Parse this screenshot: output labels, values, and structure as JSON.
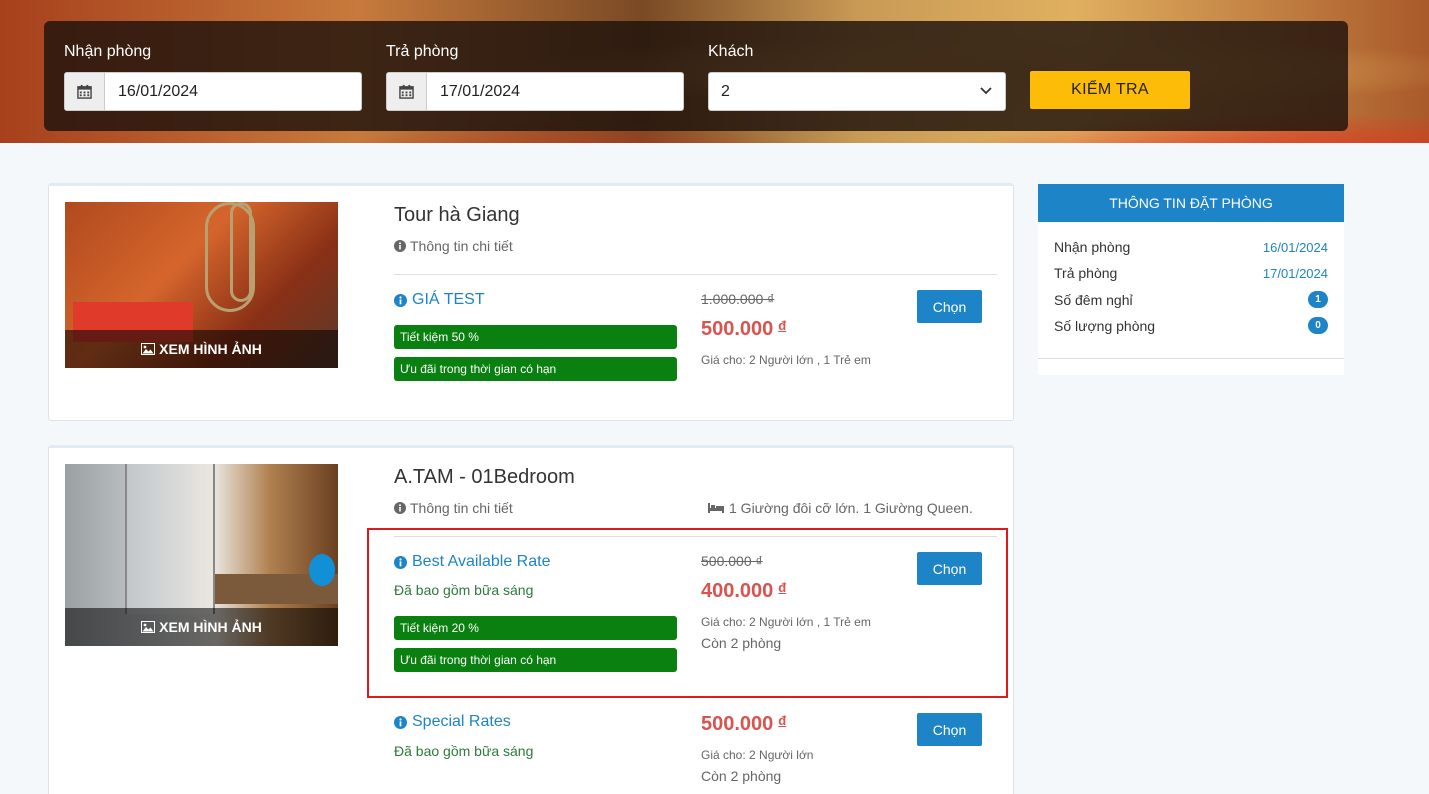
{
  "search": {
    "checkin_label": "Nhận phòng",
    "checkin_value": "16/01/2024",
    "checkout_label": "Trả phòng",
    "checkout_value": "17/01/2024",
    "guests_label": "Khách",
    "guests_value": "2",
    "check_button": "KIỂM TRA"
  },
  "rooms": [
    {
      "name": "Tour hà Giang",
      "info_link": "Thông tin chi tiết",
      "view_photos": "XEM HÌNH ẢNH",
      "rates": [
        {
          "name": "GIÁ TEST",
          "badges": [
            "Tiết kiệm 50 %",
            "Ưu đãi trong thời gian có hạn"
          ],
          "old_price": "1.000.000 ₫",
          "price": "500.000",
          "currency": "đ",
          "price_for": "Giá cho: 2 Người lớn , 1 Trẻ em",
          "button": "Chọn"
        }
      ]
    },
    {
      "name": "A.TAM - 01Bedroom",
      "info_link": "Thông tin chi tiết",
      "beds": "1 Giường đôi cỡ lớn. 1 Giường Queen.",
      "view_photos": "XEM HÌNH ẢNH",
      "rates": [
        {
          "name": "Best Available Rate",
          "breakfast": "Đã bao gồm bữa sáng",
          "badges": [
            "Tiết kiệm 20 %",
            "Ưu đãi trong thời gian có hạn"
          ],
          "old_price": "500.000 ₫",
          "price": "400.000",
          "currency": "đ",
          "price_for": "Giá cho: 2 Người lớn , 1 Trẻ em",
          "remaining": "Còn 2 phòng",
          "button": "Chọn"
        },
        {
          "name": "Special Rates",
          "breakfast": "Đã bao gồm bữa sáng",
          "price": "500.000",
          "currency": "đ",
          "price_for": "Giá cho: 2 Người lớn",
          "remaining": "Còn 2 phòng",
          "button": "Chọn"
        }
      ]
    }
  ],
  "summary": {
    "title": "THÔNG TIN ĐẶT PHÒNG",
    "checkin_label": "Nhận phòng",
    "checkin_value": "16/01/2024",
    "checkout_label": "Trả phòng",
    "checkout_value": "17/01/2024",
    "nights_label": "Số đêm nghỉ",
    "nights_value": "1",
    "rooms_label": "Số lượng phòng",
    "rooms_value": "0"
  },
  "colors": {
    "primary": "#1e84c8",
    "accent": "#fdbc07",
    "badge": "#0a8010",
    "price": "#d9534f",
    "highlight": "#e01a1a"
  }
}
